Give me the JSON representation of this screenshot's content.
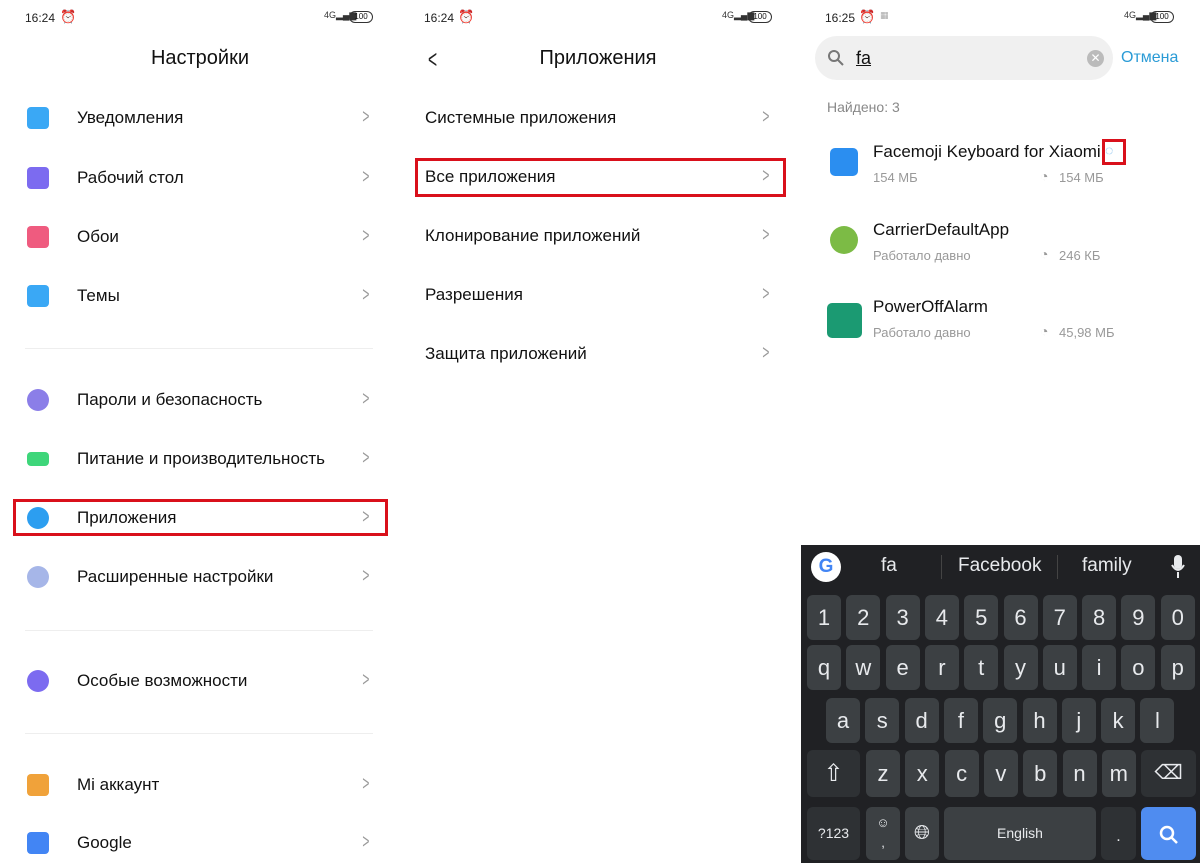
{
  "colors": {
    "accent": "#0d84ff",
    "highlight": "#d9101b",
    "kb_bg": "#202124",
    "kb_key": "#3c4043",
    "search_key": "#4f8cf0"
  },
  "left": {
    "time": "16:24",
    "network": "4G",
    "battery": "100",
    "title": "Настройки",
    "items": [
      {
        "label": "Уведомления",
        "icon": "notification-icon",
        "color": "#3aa8f5"
      },
      {
        "label": "Рабочий стол",
        "icon": "home-icon",
        "color": "#7c6bf0"
      },
      {
        "label": "Обои",
        "icon": "tulip-icon",
        "color": "#ef5b7f"
      },
      {
        "label": "Темы",
        "icon": "brush-icon",
        "color": "#3aa8f5"
      },
      {
        "label": "Пароли и безопасность",
        "icon": "fingerprint-icon",
        "color": "#8b7ee8"
      },
      {
        "label": "Питание и производительность",
        "icon": "battery-icon",
        "color": "#3ed67a"
      },
      {
        "label": "Приложения",
        "icon": "gear-icon",
        "color": "#2c9ef0",
        "highlighted": true
      },
      {
        "label": "Расширенные настройки",
        "icon": "more-icon",
        "color": "#a6b6e8"
      },
      {
        "label": "Особые возможности",
        "icon": "accessibility-icon",
        "color": "#7c6bf0"
      },
      {
        "label": "Mi аккаунт",
        "icon": "mi-logo-icon",
        "color": "#f0a23a"
      },
      {
        "label": "Google",
        "icon": "google-icon",
        "color": "#4285f4"
      }
    ]
  },
  "middle": {
    "time": "16:24",
    "network": "4G",
    "battery": "100",
    "title": "Приложения",
    "items": [
      {
        "label": "Системные приложения"
      },
      {
        "label": "Все приложения",
        "highlighted": true
      },
      {
        "label": "Клонирование приложений"
      },
      {
        "label": "Разрешения"
      },
      {
        "label": "Защита приложений"
      }
    ]
  },
  "right": {
    "time": "16:25",
    "network": "4G",
    "battery": "100",
    "search": {
      "value": "fa",
      "cancel": "Отмена"
    },
    "found": "Найдено: 3",
    "apps": [
      {
        "name": "Facemoji Keyboard for Xiaomi",
        "sub": "154 МБ",
        "size": "154 МБ",
        "icon": "facemoji-icon",
        "loading": true
      },
      {
        "name": "CarrierDefaultApp",
        "sub": "Работало давно",
        "size": "246 КБ",
        "icon": "android-gear-icon"
      },
      {
        "name": "PowerOffAlarm",
        "sub": "Работало давно",
        "size": "45,98 МБ",
        "icon": "android-icon"
      }
    ]
  },
  "keyboard": {
    "suggestions": [
      "fa",
      "Facebook",
      "family"
    ],
    "rows": [
      [
        "1",
        "2",
        "3",
        "4",
        "5",
        "6",
        "7",
        "8",
        "9",
        "0"
      ],
      [
        "q",
        "w",
        "e",
        "r",
        "t",
        "y",
        "u",
        "i",
        "o",
        "p"
      ],
      [
        "a",
        "s",
        "d",
        "f",
        "g",
        "h",
        "j",
        "k",
        "l"
      ],
      [
        "z",
        "x",
        "c",
        "v",
        "b",
        "n",
        "m"
      ]
    ],
    "symbols": "?123",
    "space": "English",
    "period": ".",
    "comma": ","
  }
}
